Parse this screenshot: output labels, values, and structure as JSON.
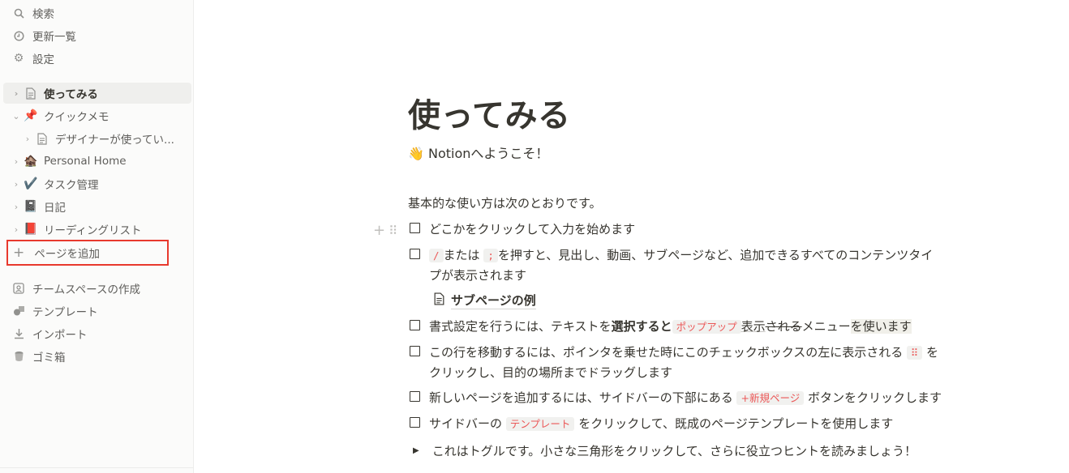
{
  "sidebar": {
    "search": "検索",
    "updates": "更新一覧",
    "settings": "設定",
    "pages": [
      {
        "label": "使ってみる",
        "icon": "📄"
      },
      {
        "label": "クイックメモ",
        "icon": "📌"
      },
      {
        "label": "デザイナーが使ってい...",
        "icon": "📄"
      },
      {
        "label": "Personal Home",
        "icon": "🏚️"
      },
      {
        "label": "タスク管理",
        "icon": "✔️"
      },
      {
        "label": "日記",
        "icon": "📓"
      },
      {
        "label": "リーディングリスト",
        "icon": "📕"
      }
    ],
    "add_page": "ページを追加",
    "create_teamspace": "チームスペースの作成",
    "templates": "テンプレート",
    "import": "インポート",
    "trash": "ゴミ箱"
  },
  "page": {
    "title": "使ってみる",
    "subtitle_emoji": "👋",
    "subtitle": "Notionへようこそ！",
    "intro": "基本的な使い方は次のとおりです。",
    "todo1": "どこかをクリックして入力を始めます",
    "todo2": {
      "code1": "/",
      "t1": "または",
      "code2": ";",
      "t2": "を押すと、見出し、動画、サブページなど、追加できるすべてのコンテンツタイ",
      "t3": "プが表示されます"
    },
    "subpage": "サブページの例",
    "todo3": {
      "t1": "書式設定を行うには、テキストを",
      "bold": "選択すると",
      "tag": "ポップアップ",
      "u": "表示",
      "s": "される",
      "t2": "メニュー",
      "hl": "を使います"
    },
    "todo4": {
      "t1": "この行を移動するには、ポインタを乗せた時にこのチェックボックスの左に表示される",
      "tag": "⠿",
      "t2": "を",
      "t3": "クリックし、目的の場所までドラッグします"
    },
    "todo5": {
      "t1": "新しいページを追加するには、サイドバーの下部にある",
      "tag": "+新規ページ",
      "t2": "ボタンをクリックします"
    },
    "todo6": {
      "t1": "サイドバーの",
      "tag": "テンプレート",
      "t2": "をクリックして、既成のページテンプレートを使用します"
    },
    "toggle": "これはトグルです。小さな三角形をクリックして、さらに役立つヒントを読みましょう！"
  }
}
